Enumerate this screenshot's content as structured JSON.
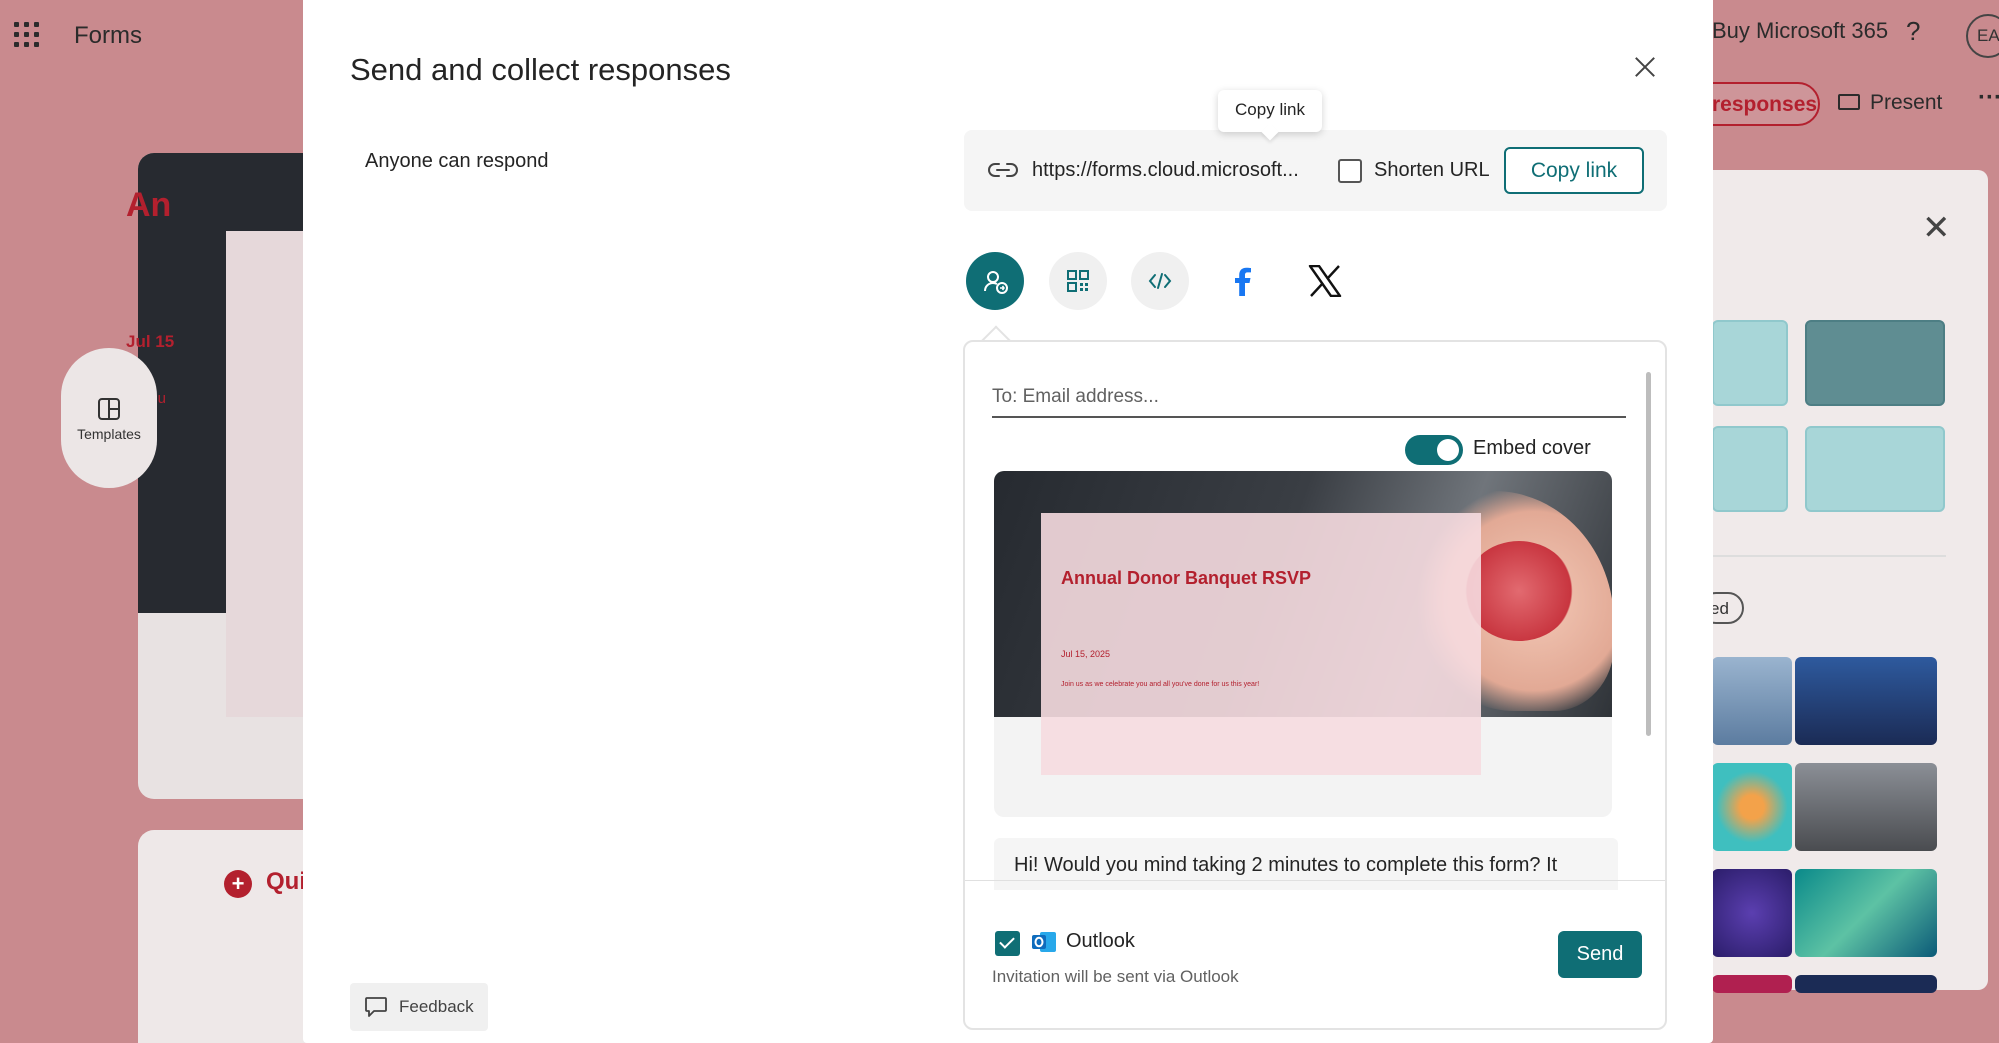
{
  "app": {
    "name": "Forms"
  },
  "background": {
    "header_right": "Buy Microsoft 365",
    "help": "?",
    "avatar": "EA",
    "responses_label": "responses",
    "present_label": "Present",
    "more": "···",
    "templates_label": "Templates",
    "card_title": "An",
    "card_date": "Jul 15",
    "card_join": "Join u",
    "quiz_label": "Qui",
    "pill_label": "ed",
    "side_close": "✕"
  },
  "modal": {
    "title": "Send and collect responses",
    "audience": "Anyone can respond",
    "link": {
      "url": "https://forms.cloud.microsoft...",
      "shorten_label": "Shorten URL",
      "shorten_checked": false,
      "copy_label": "Copy link",
      "tooltip": "Copy link"
    },
    "share_options": [
      {
        "icon": "invite-people-icon",
        "active": true
      },
      {
        "icon": "qr-code-icon",
        "active": false
      },
      {
        "icon": "embed-code-icon",
        "active": false
      },
      {
        "icon": "facebook-icon",
        "active": false
      },
      {
        "icon": "x-logo-icon",
        "active": false
      }
    ],
    "email": {
      "placeholder": "To: Email address...",
      "embed_cover_label": "Embed cover",
      "embed_cover_on": true,
      "cover": {
        "title": "Annual Donor Banquet RSVP",
        "date": "Jul 15, 2025",
        "join": "Join us as we celebrate you and all you've done for us this year!"
      },
      "message": "Hi! Would you mind taking 2 minutes to complete this form? It",
      "outlook_label": "Outlook",
      "outlook_checked": true,
      "invite_note": "Invitation will be sent via Outlook",
      "send_label": "Send"
    },
    "feedback_label": "Feedback"
  },
  "colors": {
    "accent": "#0f6e75",
    "brand_red": "#b3202e",
    "backdrop": "#c98a8e",
    "facebook": "#1877f2",
    "outlook": "#0f6cbd"
  }
}
